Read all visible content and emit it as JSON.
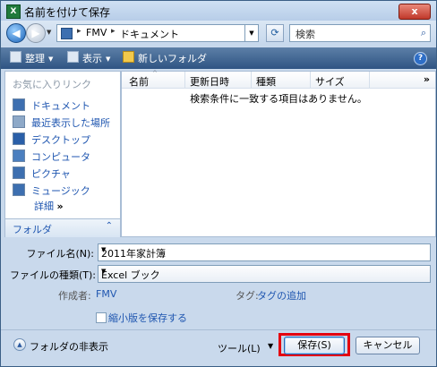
{
  "window": {
    "title": "名前を付けて保存",
    "app_icon": "excel-icon",
    "close_label": "x"
  },
  "address": {
    "crumbs": [
      "FMV",
      "ドキュメント"
    ],
    "search_placeholder": "検索"
  },
  "toolbar": {
    "organize": "整理",
    "views": "表示",
    "new_folder": "新しいフォルダ"
  },
  "navpane": {
    "favorites_header": "お気に入りリンク",
    "items": [
      {
        "label": "ドキュメント",
        "icon": "documents-icon",
        "color": "#3d6fb0"
      },
      {
        "label": "最近表示した場所",
        "icon": "recent-places-icon",
        "color": "#8ea9c8"
      },
      {
        "label": "デスクトップ",
        "icon": "desktop-icon",
        "color": "#2a5fa8"
      },
      {
        "label": "コンピュータ",
        "icon": "computer-icon",
        "color": "#4b7fbf"
      },
      {
        "label": "ピクチャ",
        "icon": "pictures-icon",
        "color": "#3d6fb0"
      },
      {
        "label": "ミュージック",
        "icon": "music-icon",
        "color": "#3d6fb0"
      }
    ],
    "more_label": "詳細",
    "more_chevron": "»",
    "folders_label": "フォルダ",
    "folders_caret": "⌃"
  },
  "filelist": {
    "columns": [
      "名前",
      "更新日時",
      "種類",
      "サイズ"
    ],
    "more": "»",
    "empty_message": "検索条件に一致する項目はありません。"
  },
  "form": {
    "filename_label": "ファイル名(N):",
    "filename_value": "2011年家計簿",
    "filetype_label": "ファイルの種類(T):",
    "filetype_value": "Excel ブック",
    "author_label": "作成者:",
    "author_value": "FMV",
    "tags_label": "タグ:",
    "tags_value": "タグの追加",
    "thumbnail_label": "縮小版を保存する"
  },
  "footer": {
    "hide_folders": "フォルダの非表示",
    "tools": "ツール(L)",
    "save": "保存(S)",
    "cancel": "キャンセル",
    "highlight_color": "#e4000f"
  }
}
